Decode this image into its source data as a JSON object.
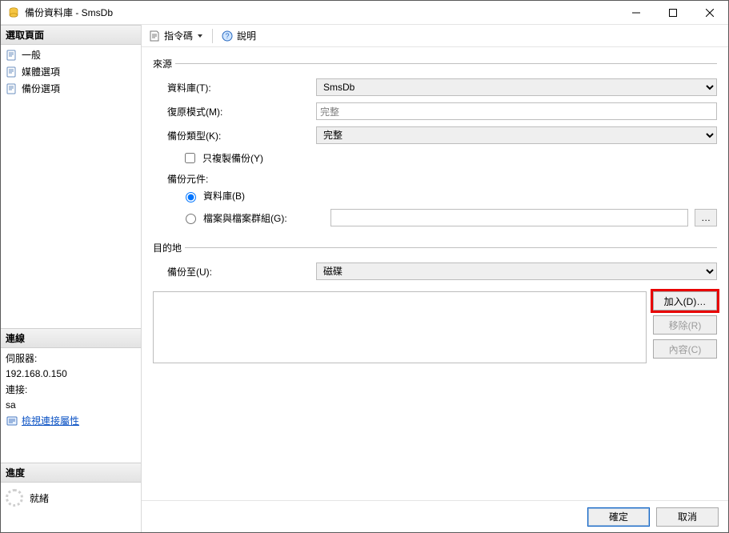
{
  "window": {
    "title": "備份資料庫 - SmsDb"
  },
  "sidebar": {
    "select_page_header": "選取頁面",
    "items": [
      {
        "label": "一般"
      },
      {
        "label": "媒體選項"
      },
      {
        "label": "備份選項"
      }
    ],
    "connection_header": "連線",
    "server_label": "伺服器:",
    "server_value": "192.168.0.150",
    "conn_label": "連接:",
    "conn_value": "sa",
    "view_conn_link": "檢視連接屬性",
    "progress_header": "進度",
    "progress_status": "就緒"
  },
  "toolbar": {
    "script_label": "指令碼",
    "help_label": "說明"
  },
  "source": {
    "legend": "來源",
    "db_label": "資料庫(T):",
    "db_value": "SmsDb",
    "recovery_label": "復原模式(M):",
    "recovery_value": "完整",
    "backup_type_label": "備份類型(K):",
    "backup_type_value": "完整",
    "copy_only_label": "只複製備份(Y)",
    "component_label": "備份元件:",
    "radio_db_label": "資料庫(B)",
    "radio_file_label": "檔案與檔案群組(G):"
  },
  "destination": {
    "legend": "目的地",
    "backup_to_label": "備份至(U):",
    "backup_to_value": "磁碟",
    "add_label": "加入(D)…",
    "remove_label": "移除(R)",
    "contents_label": "內容(C)"
  },
  "footer": {
    "ok_label": "確定",
    "cancel_label": "取消"
  }
}
